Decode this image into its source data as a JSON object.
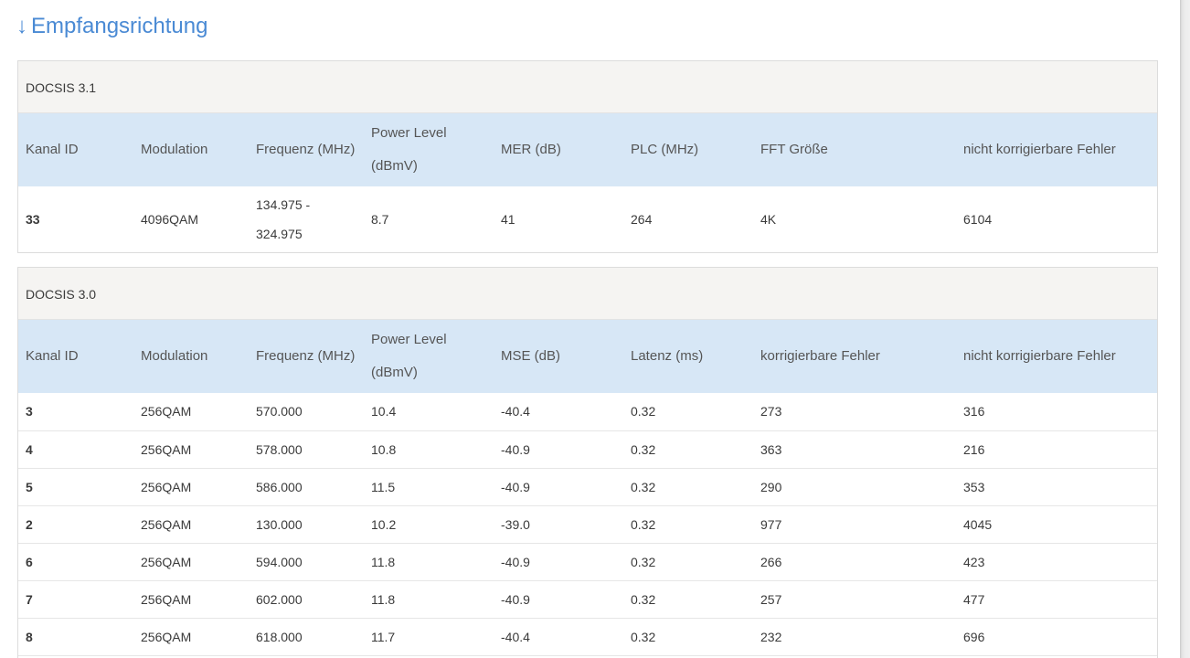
{
  "heading": {
    "arrow": "↓",
    "title": "Empfangsrichtung"
  },
  "docsis31": {
    "title": "DOCSIS 3.1",
    "columns": [
      "Kanal ID",
      "Modulation",
      "Frequenz (MHz)",
      "Power Level (dBmV)",
      "MER (dB)",
      "PLC (MHz)",
      "FFT Größe",
      "nicht korrigierbare Fehler"
    ],
    "rows": [
      [
        "33",
        "4096QAM",
        "134.975 - 324.975",
        "8.7",
        "41",
        "264",
        "4K",
        "6104"
      ]
    ]
  },
  "docsis30": {
    "title": "DOCSIS 3.0",
    "columns": [
      "Kanal ID",
      "Modulation",
      "Frequenz (MHz)",
      "Power Level (dBmV)",
      "MSE (dB)",
      "Latenz (ms)",
      "korrigierbare Fehler",
      "nicht korrigierbare Fehler"
    ],
    "rows": [
      [
        "3",
        "256QAM",
        "570.000",
        "10.4",
        "-40.4",
        "0.32",
        "273",
        "316"
      ],
      [
        "4",
        "256QAM",
        "578.000",
        "10.8",
        "-40.9",
        "0.32",
        "363",
        "216"
      ],
      [
        "5",
        "256QAM",
        "586.000",
        "11.5",
        "-40.9",
        "0.32",
        "290",
        "353"
      ],
      [
        "2",
        "256QAM",
        "130.000",
        "10.2",
        "-39.0",
        "0.32",
        "977",
        "4045"
      ],
      [
        "6",
        "256QAM",
        "594.000",
        "11.8",
        "-40.9",
        "0.32",
        "266",
        "423"
      ],
      [
        "7",
        "256QAM",
        "602.000",
        "11.8",
        "-40.9",
        "0.32",
        "257",
        "477"
      ],
      [
        "8",
        "256QAM",
        "618.000",
        "11.7",
        "-40.4",
        "0.32",
        "232",
        "696"
      ]
    ]
  },
  "colors": {
    "heading": "#4a8ad4",
    "header_row": "#d7e7f6",
    "title_bar": "#f5f4f2",
    "border": "#dcdcdc"
  }
}
